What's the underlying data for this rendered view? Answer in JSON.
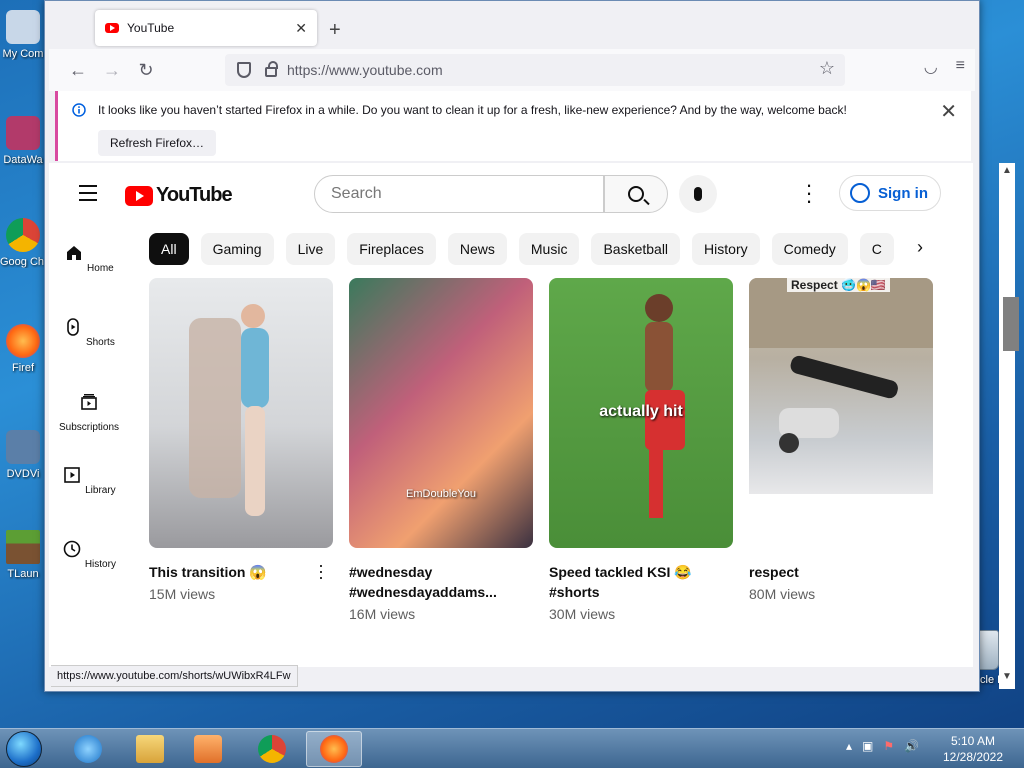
{
  "desktop": {
    "icons": [
      {
        "label": "My Com"
      },
      {
        "label": "DataWa"
      },
      {
        "label": "Goog Chro"
      },
      {
        "label": "Firef"
      },
      {
        "label": "DVDVi"
      },
      {
        "label": "TLaun"
      }
    ],
    "recycle_label": "Recycle Bin"
  },
  "browser": {
    "tab_title": "YouTube",
    "url": "https://www.youtube.com",
    "notice_text": "It looks like you haven’t started Firefox in a while. Do you want to clean it up for a fresh, like-new experience? And by the way, welcome back!",
    "refresh_label": "Refresh Firefox…",
    "status_url": "https://www.youtube.com/shorts/wUWibxR4LFw"
  },
  "youtube": {
    "logo_text": "YouTube",
    "search_placeholder": "Search",
    "signin_label": "Sign in",
    "chips": [
      "All",
      "Gaming",
      "Live",
      "Fireplaces",
      "News",
      "Music",
      "Basketball",
      "History",
      "Comedy",
      "C"
    ],
    "sidebar": [
      {
        "label": "Home"
      },
      {
        "label": "Shorts"
      },
      {
        "label": "Subscriptions"
      },
      {
        "label": "Library"
      },
      {
        "label": "History"
      }
    ],
    "videos": [
      {
        "title": "This transition 😱",
        "views": "15M views",
        "overlay": "",
        "thumb": "#cfd2d6"
      },
      {
        "title": "#wednesday #wednesdayaddams...",
        "views": "16M views",
        "overlay": "EmDoubleYou",
        "thumb": "#b87a8a"
      },
      {
        "title": "Speed tackled KSI 😂 #shorts",
        "views": "30M views",
        "overlay": "actually hit",
        "thumb": "#5fa84a"
      },
      {
        "title": "respect",
        "views": "80M views",
        "overlay": "Respect 🥶😱🇺🇸",
        "thumb": "#a9b3bd"
      }
    ]
  },
  "taskbar": {
    "time": "5:10 AM",
    "date": "12/28/2022"
  }
}
